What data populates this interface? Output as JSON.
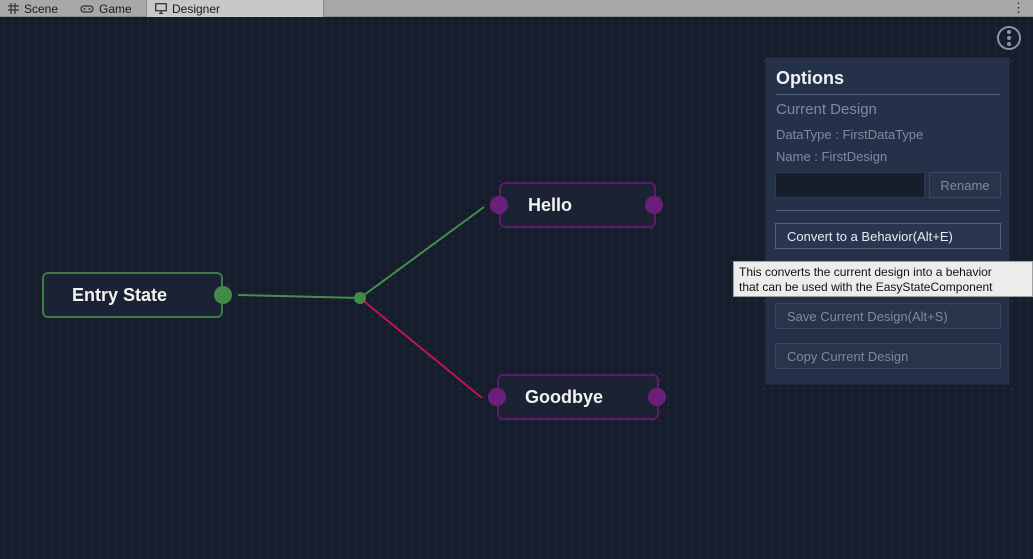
{
  "tabs": [
    {
      "label": "Scene",
      "icon": "grid-icon"
    },
    {
      "label": "Game",
      "icon": "gamepad-icon"
    },
    {
      "label": "Designer",
      "icon": "monitor-icon",
      "active": true
    }
  ],
  "tab_menu_glyph": "⋮",
  "graph": {
    "nodes": {
      "entry": {
        "label": "Entry State",
        "color": "#3f7a44"
      },
      "hello": {
        "label": "Hello",
        "color": "#5c1a6b"
      },
      "goodbye": {
        "label": "Goodbye",
        "color": "#5c1a6b"
      }
    },
    "colors": {
      "entry_port": "#418a49",
      "state_port": "#6b1f7a",
      "link_true": "#44904b",
      "link_false": "#c0144f"
    }
  },
  "options": {
    "title": "Options",
    "section": "Current Design",
    "data_type": "DataType : FirstDataType",
    "name": "Name : FirstDesign",
    "rename_value": "",
    "rename_button": "Rename",
    "convert_button": "Convert to a Behavior(Alt+E)",
    "save_button": "Save Current Design(Alt+S)",
    "copy_button": "Copy Current Design"
  },
  "tooltip": {
    "line1": "This converts the current design into a behavior",
    "line2": "that can be used with the EasyStateComponent"
  }
}
